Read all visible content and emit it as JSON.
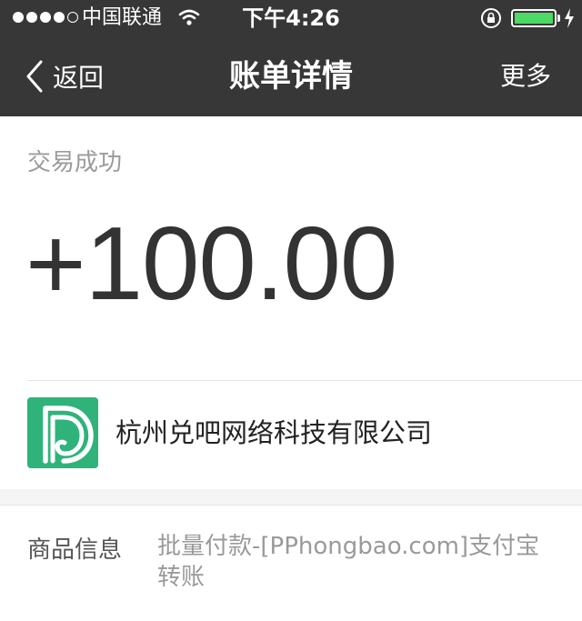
{
  "status_bar": {
    "carrier": "中国联通",
    "time": "下午4:26",
    "battery_level": 1.0,
    "battery_color": "#4cd964"
  },
  "nav": {
    "back_label": "返回",
    "title": "账单详情",
    "more_label": "更多"
  },
  "transaction": {
    "status": "交易成功",
    "amount": "+100.00",
    "merchant": "杭州兑吧网络科技有限公司",
    "logo_color": "#2fb37a"
  },
  "product_info": {
    "label": "商品信息",
    "value": "批量付款-[PPhongbao.com]支付宝转账"
  },
  "colors": {
    "header_bg": "#373737",
    "page_bg": "#f5f5f5"
  }
}
